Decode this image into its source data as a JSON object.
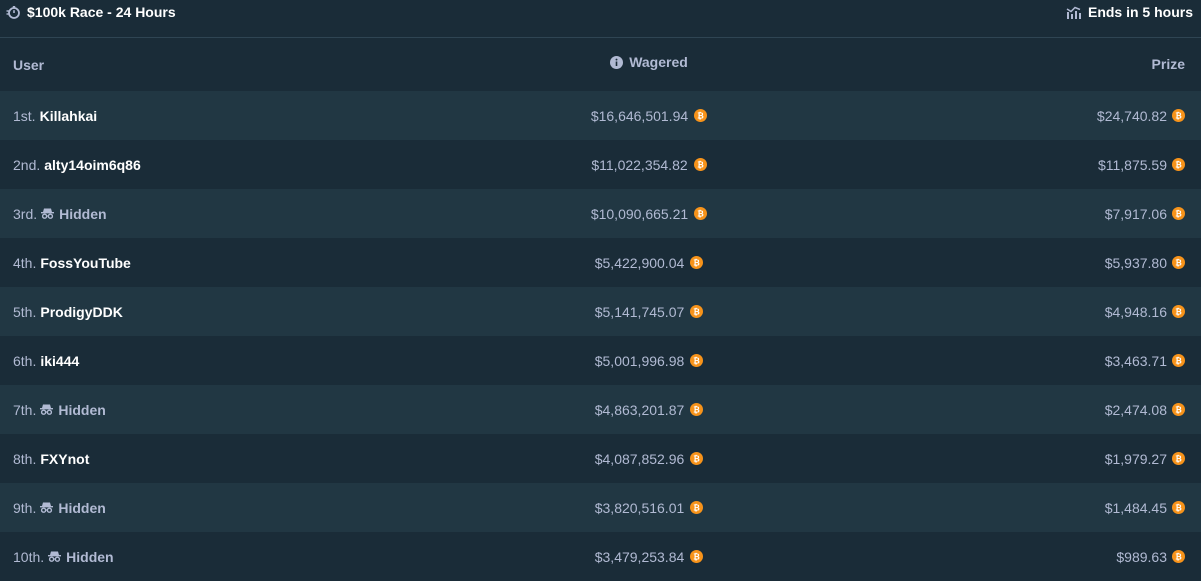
{
  "header": {
    "title": "$100k Race - 24 Hours",
    "status": "Ends in 5 hours"
  },
  "columns": {
    "user": "User",
    "wagered": "Wagered",
    "prize": "Prize"
  },
  "colors": {
    "background": "#1a2c38",
    "row_alt": "#213743",
    "text_primary": "#ffffff",
    "text_secondary": "#b1bad3",
    "btc": "#f7931a"
  },
  "rows": [
    {
      "rank": "1st.",
      "name": "Killahkai",
      "hidden": false,
      "wagered": "$16,646,501.94",
      "prize": "$24,740.82"
    },
    {
      "rank": "2nd.",
      "name": "alty14oim6q86",
      "hidden": false,
      "wagered": "$11,022,354.82",
      "prize": "$11,875.59"
    },
    {
      "rank": "3rd.",
      "name": "Hidden",
      "hidden": true,
      "wagered": "$10,090,665.21",
      "prize": "$7,917.06"
    },
    {
      "rank": "4th.",
      "name": "FossYouTube",
      "hidden": false,
      "wagered": "$5,422,900.04",
      "prize": "$5,937.80"
    },
    {
      "rank": "5th.",
      "name": "ProdigyDDK",
      "hidden": false,
      "wagered": "$5,141,745.07",
      "prize": "$4,948.16"
    },
    {
      "rank": "6th.",
      "name": "iki444",
      "hidden": false,
      "wagered": "$5,001,996.98",
      "prize": "$3,463.71"
    },
    {
      "rank": "7th.",
      "name": "Hidden",
      "hidden": true,
      "wagered": "$4,863,201.87",
      "prize": "$2,474.08"
    },
    {
      "rank": "8th.",
      "name": "FXYnot",
      "hidden": false,
      "wagered": "$4,087,852.96",
      "prize": "$1,979.27"
    },
    {
      "rank": "9th.",
      "name": "Hidden",
      "hidden": true,
      "wagered": "$3,820,516.01",
      "prize": "$1,484.45"
    },
    {
      "rank": "10th.",
      "name": "Hidden",
      "hidden": true,
      "wagered": "$3,479,253.84",
      "prize": "$989.63"
    }
  ]
}
